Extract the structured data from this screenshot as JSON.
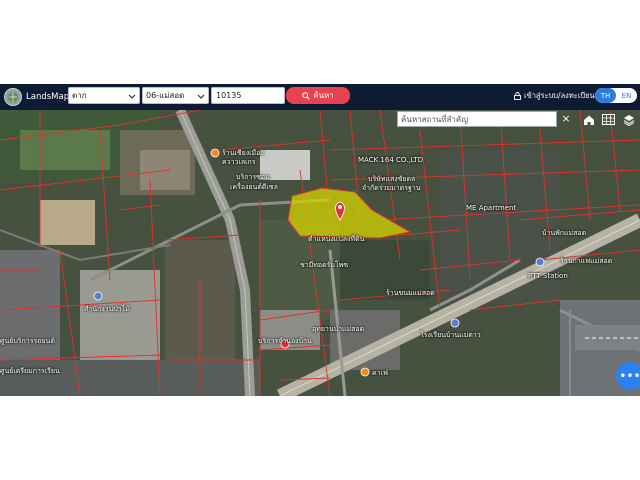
{
  "header": {
    "app_name": "LandsMaps",
    "province_select": "ตาก",
    "district_select": "06-แม่สอด",
    "postcode_value": "10135",
    "search_label": "ค้นหา",
    "login_label": "เข้าสู่ระบบ/ลงทะเบียน",
    "lang_th": "TH",
    "lang_en": "EN"
  },
  "map": {
    "place_search_placeholder": "ค้นหาสถานที่สำคัญ",
    "close_label": "×",
    "fab_label": "•••",
    "labels": [
      "ร้านเชียงเมือง",
      "ควาวเลเกร",
      "บริการซ่อม",
      "เครื่องยนต์ดีเซล",
      "MACK 164 CO.,LTD",
      "บริษัทแสงชัยดล",
      "จำกัดร่วมมาตรฐาน",
      "ME Apartment",
      "ตำแหน่งแปลงที่ดิน",
      "ชามีทอดรัมโพซ",
      "ร้านกาแฟแม่สอด",
      "PTT Station",
      "ร้านขนมแม่สอด",
      "โรงเรียนบ้านแม่ตาว",
      "อุทยานป่าแม่สอด",
      "ศูนย์บริการรถยนต์",
      "บริการจำนองบ้าน",
      "ศูนย์เตรียมการเรียน",
      "สำนักงานป่าไม้",
      "บ้านพักแม่สอด",
      "คาเฟ่"
    ]
  },
  "colors": {
    "header_bg": "#0e1c33",
    "search_button": "#e8424f",
    "accent_blue": "#2a7be4",
    "parcel_fill": "#d6d400",
    "parcel_line": "#e0322e",
    "pin": "#e8303a"
  },
  "icons": {
    "logo": "globe-logo-icon",
    "search": "search-icon",
    "lock": "lock-icon",
    "home": "home-icon",
    "grid": "grid-icon",
    "layers": "layers-icon",
    "pin": "map-pin-icon"
  }
}
